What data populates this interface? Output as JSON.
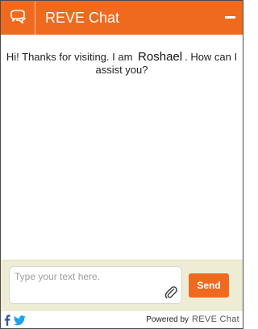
{
  "header": {
    "title": "REVE Chat"
  },
  "welcome": {
    "before": "Hi! Thanks for visiting. I am",
    "agent_name": "Roshael",
    "after": ". How can I assist you?"
  },
  "composer": {
    "placeholder": "Type your text here.",
    "send_label": "Send"
  },
  "footer": {
    "powered_by": "Powered by",
    "brand": "REVE Chat"
  },
  "icons": {
    "logo": "chat-bubble-icon",
    "minimize": "minimize-icon",
    "attach": "paperclip-icon",
    "facebook": "facebook-icon",
    "twitter": "twitter-icon"
  },
  "colors": {
    "accent": "#ef6a1f",
    "composer_bg": "#efecd6",
    "text": "#1f1f1f"
  }
}
